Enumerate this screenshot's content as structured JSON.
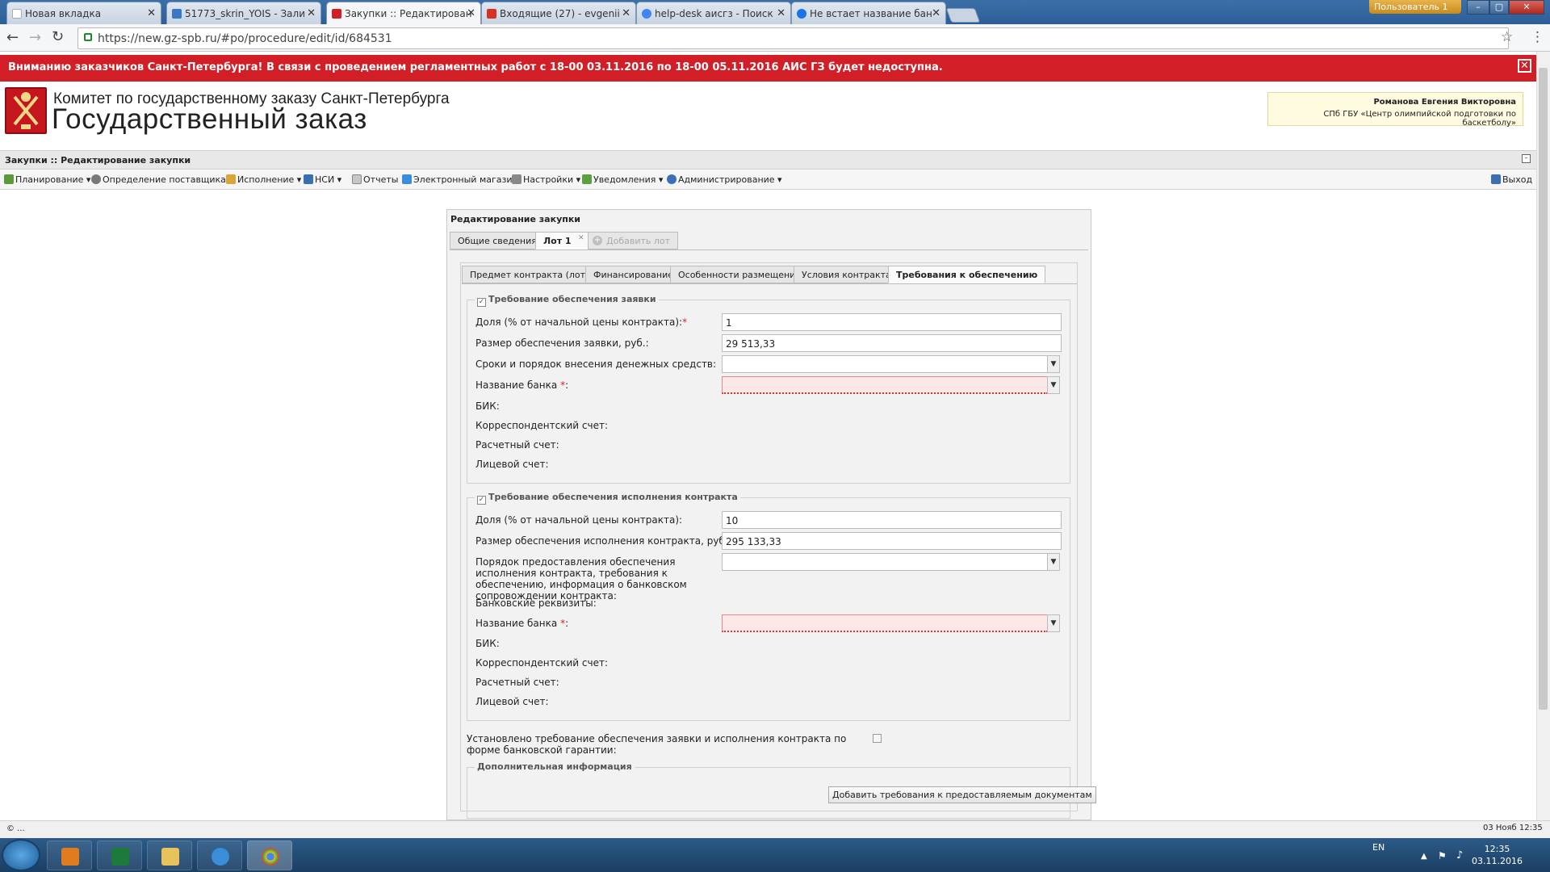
{
  "browser": {
    "tabs": [
      {
        "label": "Новая вкладка",
        "color": "#ffffff"
      },
      {
        "label": "51773_skrin_YOIS - Зали",
        "color": "#3b78c4"
      },
      {
        "label": "Закупки :: Редактирован",
        "color": "#d21f27"
      },
      {
        "label": "Входящие (27) - evgenii",
        "color": "#d93025"
      },
      {
        "label": "help-desk аисгз - Поиск",
        "color": "#4285f4"
      },
      {
        "label": "Не встает название бан",
        "color": "#1a73e8"
      }
    ],
    "user_badge": "Пользователь 1",
    "url": "https://new.gz-spb.ru/#po/procedure/edit/id/684531"
  },
  "banner": {
    "text": "Вниманию заказчиков Санкт-Петербурга! В связи с проведением регламентных работ с 18-00 03.11.2016 по 18-00 05.11.2016 АИС ГЗ будет недоступна.",
    "close": "✕",
    "color": "#d21f27"
  },
  "header": {
    "org": "Комитет по государственному заказу Санкт-Петербурга",
    "product": "Государственный заказ",
    "user_name": "Романова Евгения Викторовна",
    "user_org": "СПб ГБУ «Центр олимпийской подготовки по баскетболу»"
  },
  "page_title": "Закупки :: Редактирование закупки",
  "menu": [
    {
      "label": "Планирование ▾",
      "icon": "planning-icon"
    },
    {
      "label": "Определение поставщика ▾",
      "icon": "supplier-icon"
    },
    {
      "label": "Исполнение ▾",
      "icon": "execution-icon"
    },
    {
      "label": "НСИ ▾",
      "icon": "nsi-icon"
    },
    {
      "label": "Отчеты",
      "icon": "reports-icon"
    },
    {
      "label": "Электронный магазин",
      "icon": "eshop-icon"
    },
    {
      "label": "Настройки ▾",
      "icon": "settings-icon"
    },
    {
      "label": "Уведомления ▾",
      "icon": "notifications-icon"
    },
    {
      "label": "Администрирование ▾",
      "icon": "admin-icon"
    }
  ],
  "logout": "Выход",
  "panel": {
    "title": "Редактирование закупки",
    "tabs": [
      "Общие сведения",
      "Лот 1",
      "Добавить лот"
    ],
    "subtabs": [
      "Предмет контракта (лота)",
      "Финансирование",
      "Особенности размещения",
      "Условия контракта",
      "Требования к обеспечению"
    ],
    "active_subtab": "Требования к обеспечению"
  },
  "app_sec": {
    "legend": "Требование обеспечения заявки",
    "share_label": "Доля (% от начальной цены контракта):",
    "share_value": "1",
    "amount_label": "Размер обеспечения заявки, руб.:",
    "amount_value": "29 513,33",
    "terms_label": "Сроки и порядок внесения денежных средств:",
    "bank_label": "Название банка",
    "bik_label": "БИК:",
    "corr_label": "Корреспондентский счет:",
    "settle_label": "Расчетный счет:",
    "personal_label": "Лицевой счет:"
  },
  "contract_sec": {
    "legend": "Требование обеспечения исполнения контракта",
    "share_label": "Доля (% от начальной цены контракта):",
    "share_value": "10",
    "amount_label": "Размер обеспечения исполнения контракта, руб.:",
    "amount_value": "295 133,33",
    "order_label": "Порядок предоставления обеспечения исполнения контракта, требования к обеспечению, информация о банковском сопровождении контракта:",
    "bankreq_label": "Банковские реквизиты:",
    "bank_label": "Название банка",
    "bik_label": "БИК:",
    "corr_label": "Корреспондентский счет:",
    "settle_label": "Расчетный счет:",
    "personal_label": "Лицевой счет:"
  },
  "guarantee_label": "Установлено требование обеспечения заявки и исполнения контракта по форме банковской гарантии:",
  "extra": {
    "legend": "Дополнительная информация",
    "button": "Добавить требования к предоставляемым документам"
  },
  "required_mark": "*",
  "statusbar": {
    "left": "© ...",
    "right": "03 Нояб 12:35"
  },
  "taskbar": {
    "lang": "EN",
    "time": "12:35",
    "date": "03.11.2016"
  }
}
